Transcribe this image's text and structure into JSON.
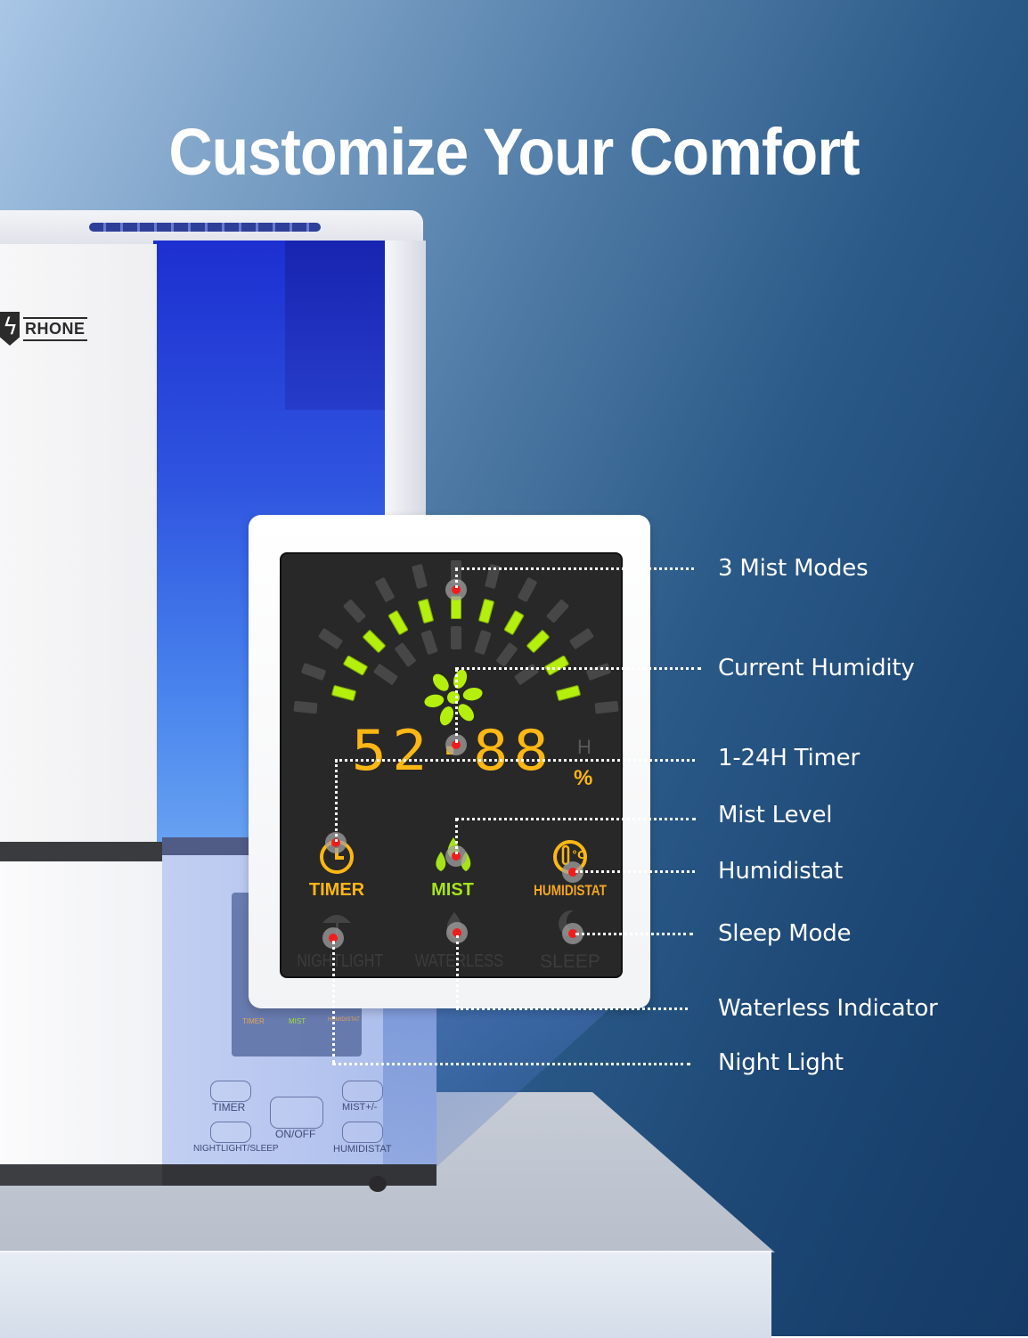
{
  "headline": "Customize Your Comfort",
  "brand": "RHONE",
  "display": {
    "readout_digits": "52·88",
    "ghost_hour_label": "H",
    "percent_symbol": "%",
    "mist_arc": {
      "lit_segments_inner": 11,
      "total_segments_inner": 11,
      "lit_segments_outer": 0
    },
    "indicators": [
      {
        "label": "TIMER",
        "icon": "clock-icon",
        "state": "on",
        "color": "#fdb714"
      },
      {
        "label": "MIST",
        "icon": "droplets-icon",
        "state": "on",
        "color": "#a6e31a"
      },
      {
        "label": "HUMIDISTAT",
        "icon": "thermometer-icon",
        "state": "on",
        "color": "#fdb714"
      },
      {
        "label": "NIGHTLIGHT",
        "icon": "lamp-icon",
        "state": "off",
        "color": "#444444"
      },
      {
        "label": "WATERLESS",
        "icon": "water-drop-icon",
        "state": "off",
        "color": "#444444"
      },
      {
        "label": "SLEEP",
        "icon": "moon-icon",
        "state": "off",
        "color": "#444444"
      }
    ]
  },
  "mini_panel": {
    "labels": [
      "TIMER",
      "MIST",
      "HUMIDISTAT"
    ]
  },
  "device_buttons": [
    {
      "label": "TIMER"
    },
    {
      "label": "ON/OFF"
    },
    {
      "label": "MIST+/-"
    },
    {
      "label": "NIGHTLIGHT/SLEEP"
    },
    {
      "label": "HUMIDISTAT"
    }
  ],
  "callouts": [
    {
      "label": "3 Mist Modes"
    },
    {
      "label": "Current Humidity"
    },
    {
      "label": "1-24H Timer"
    },
    {
      "label": "Mist Level"
    },
    {
      "label": "Humidistat"
    },
    {
      "label": "Sleep Mode"
    },
    {
      "label": "Waterless Indicator"
    },
    {
      "label": "Night Light"
    }
  ],
  "colors": {
    "segment_on": "#b5ef0d",
    "digit_amber": "#fdb714",
    "marker_red": "#f11d1d",
    "tank_blue": "#2f55e0",
    "bg_dark": "#153a66"
  }
}
